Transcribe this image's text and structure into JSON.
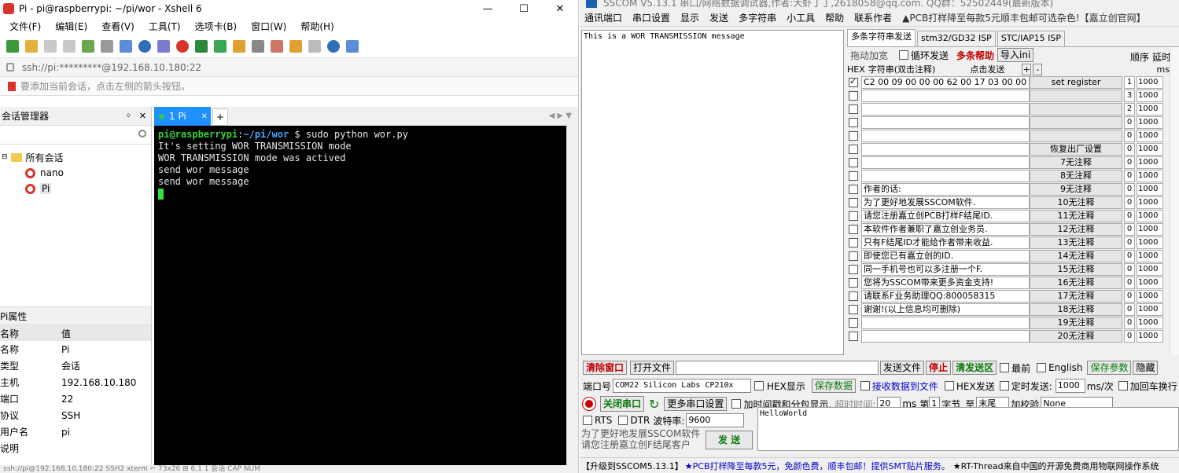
{
  "xshell": {
    "title": "Pi - pi@raspberrypi: ~/pi/wor - Xshell 6",
    "window_buttons": [
      "—",
      "☐",
      "✕"
    ],
    "menu": [
      "文件(F)",
      "编辑(E)",
      "查看(V)",
      "工具(T)",
      "选项卡(B)",
      "窗口(W)",
      "帮助(H)"
    ],
    "address": "ssh://pi:*********@192.168.10.180:22",
    "hint": "要添加当前会话，点击左侧的箭头按钮。",
    "session_manager": {
      "title": "会话管理器",
      "pin": "ᛜ",
      "close": "✕",
      "root": "所有会话",
      "items": [
        "nano",
        "Pi"
      ]
    },
    "properties": {
      "title": "Pi属性",
      "header": [
        "名称",
        "值"
      ],
      "rows": [
        [
          "名称",
          "Pi"
        ],
        [
          "类型",
          "会话"
        ],
        [
          "主机",
          "192.168.10.180"
        ],
        [
          "端口",
          "22"
        ],
        [
          "协议",
          "SSH"
        ],
        [
          "用户名",
          "pi"
        ],
        [
          "说明",
          ""
        ]
      ]
    },
    "tab": {
      "label": "1 Pi",
      "close": "✕",
      "add": "+"
    },
    "terminal": {
      "prompt_user": "pi@raspberrypi",
      "prompt_sep": ":",
      "prompt_path": "~/pi/wor",
      "prompt_end": " $ ",
      "command": "sudo python wor.py",
      "lines": [
        "It's setting WOR TRANSMISSION mode",
        "WOR TRANSMISSION mode was actived",
        "send wor message",
        "send wor message"
      ]
    },
    "status": "ssh://pi@192.168.10.180:22        SSH2   xterm   ⌐ 73x26   ⊞ 6,1   1 会话   CAP  NUM"
  },
  "sscom": {
    "title": "SSCOM V5.13.1 串口/网络数据调试器,作者:大虾丁丁,2618058@qq.com. QQ群：52502449(最新版本)",
    "menu": [
      "通讯端口",
      "串口设置",
      "显示",
      "发送",
      "多字符串",
      "小工具",
      "帮助",
      "联系作者"
    ],
    "menu_ad": "▲PCB打样降至每款5元顺丰包邮可选杂色!【嘉立创官网】",
    "receive_text": "This is a WOR TRANSMISSION message",
    "multi_tabs": [
      "多条字符串发送",
      "stm32/GD32 ISP",
      "STC/IAP15 ISP"
    ],
    "multi_opts": {
      "drag": "拖动加宽",
      "loop": "循环发送",
      "help": "多条帮助",
      "import": "导入ini",
      "order": "顺序",
      "delay": "延时"
    },
    "multi_head": {
      "hex": "HEX",
      "str": "字符串(双击注释)",
      "click": "点击发送",
      "plus": "+",
      "minus": "-",
      "ms": "ms"
    },
    "multi_rows": [
      {
        "checked": true,
        "text": "C2 00 09 00 00 00 62 00 17 03 00 00",
        "button": "set register",
        "order": "1",
        "delay": "1000"
      },
      {
        "checked": false,
        "text": "",
        "button": "",
        "order": "3",
        "delay": "1000"
      },
      {
        "checked": false,
        "text": "",
        "button": "",
        "order": "2",
        "delay": "1000"
      },
      {
        "checked": false,
        "text": "",
        "button": "",
        "order": "0",
        "delay": "1000"
      },
      {
        "checked": false,
        "text": "",
        "button": "",
        "order": "0",
        "delay": "1000"
      },
      {
        "checked": false,
        "text": "",
        "button": "恢复出厂设置",
        "order": "0",
        "delay": "1000"
      },
      {
        "checked": false,
        "text": "",
        "button": "7无注释",
        "order": "0",
        "delay": "1000"
      },
      {
        "checked": false,
        "text": "",
        "button": "8无注释",
        "order": "0",
        "delay": "1000"
      },
      {
        "checked": false,
        "text": "作者的话:",
        "button": "9无注释",
        "order": "0",
        "delay": "1000"
      },
      {
        "checked": false,
        "text": "为了更好地发展SSCOM软件.",
        "button": "10无注释",
        "order": "0",
        "delay": "1000"
      },
      {
        "checked": false,
        "text": "请您注册嘉立创PCB打样F结尾ID.",
        "button": "11无注释",
        "order": "0",
        "delay": "1000"
      },
      {
        "checked": false,
        "text": "本软件作者兼职了嘉立创业务员.",
        "button": "12无注释",
        "order": "0",
        "delay": "1000"
      },
      {
        "checked": false,
        "text": "只有F结尾ID才能给作者带来收益.",
        "button": "13无注释",
        "order": "0",
        "delay": "1000"
      },
      {
        "checked": false,
        "text": "即使您已有嘉立创的ID.",
        "button": "14无注释",
        "order": "0",
        "delay": "1000"
      },
      {
        "checked": false,
        "text": "同一手机号也可以多注册一个F.",
        "button": "15无注释",
        "order": "0",
        "delay": "1000"
      },
      {
        "checked": false,
        "text": "您将为SSCOM带来更多资金支持!",
        "button": "16无注释",
        "order": "0",
        "delay": "1000"
      },
      {
        "checked": false,
        "text": "请联系F业务助理QQ:800058315",
        "button": "17无注释",
        "order": "0",
        "delay": "1000"
      },
      {
        "checked": false,
        "text": "谢谢!(以上信息均可删除)",
        "button": "18无注释",
        "order": "0",
        "delay": "1000"
      },
      {
        "checked": false,
        "text": "",
        "button": "19无注释",
        "order": "0",
        "delay": "1000"
      },
      {
        "checked": false,
        "text": "",
        "button": "20无注释",
        "order": "0",
        "delay": "1000"
      }
    ],
    "bar1": {
      "clear": "清除窗口",
      "open_file": "打开文件",
      "send_file": "发送文件",
      "stop": "停止",
      "clear_send": "清发送区",
      "last": "最前",
      "english": "English",
      "save_params": "保存参数",
      "hide": "隐藏"
    },
    "port_label": "端口号",
    "port_value": "COM22 Silicon Labs CP210x",
    "hex_show": "HEX显示",
    "save_data": "保存数据",
    "recv_to_file": "接收数据到文件",
    "hex_send": "HEX发送",
    "timed_send": "定时发送:",
    "timed_value": "1000",
    "timed_unit": "ms/次",
    "add_crlf": "加回车换行",
    "close_port": "关闭串口",
    "more_settings": "更多串口设置",
    "timestamp": "加时间戳和分包显示,",
    "timeout_label": "超时时间:",
    "timeout_value": "20",
    "timeout_unit": "ms",
    "byte_no": "第",
    "byte_val": "1",
    "byte_unit": "字节",
    "to": "至",
    "tail": "末尾",
    "checksum": "加校验",
    "checksum_value": "None",
    "rts": "RTS",
    "dtr": "DTR",
    "baud_label": "波特率:",
    "baud_value": "9600",
    "promo1": "为了更好地发展SSCOM软件",
    "promo2": "请您注册嘉立创F结尾客户",
    "send": "发 送",
    "send_text": "HelloWorld",
    "bottom_a": "【升级到SSCOM5.13.1】",
    "bottom_b": "★PCB打样降至每款5元，免颜色费，顺丰包邮！提供SMT贴片服务。",
    "bottom_c": "★RT-Thread来自中国的开源免费商用物联网操作系统"
  }
}
